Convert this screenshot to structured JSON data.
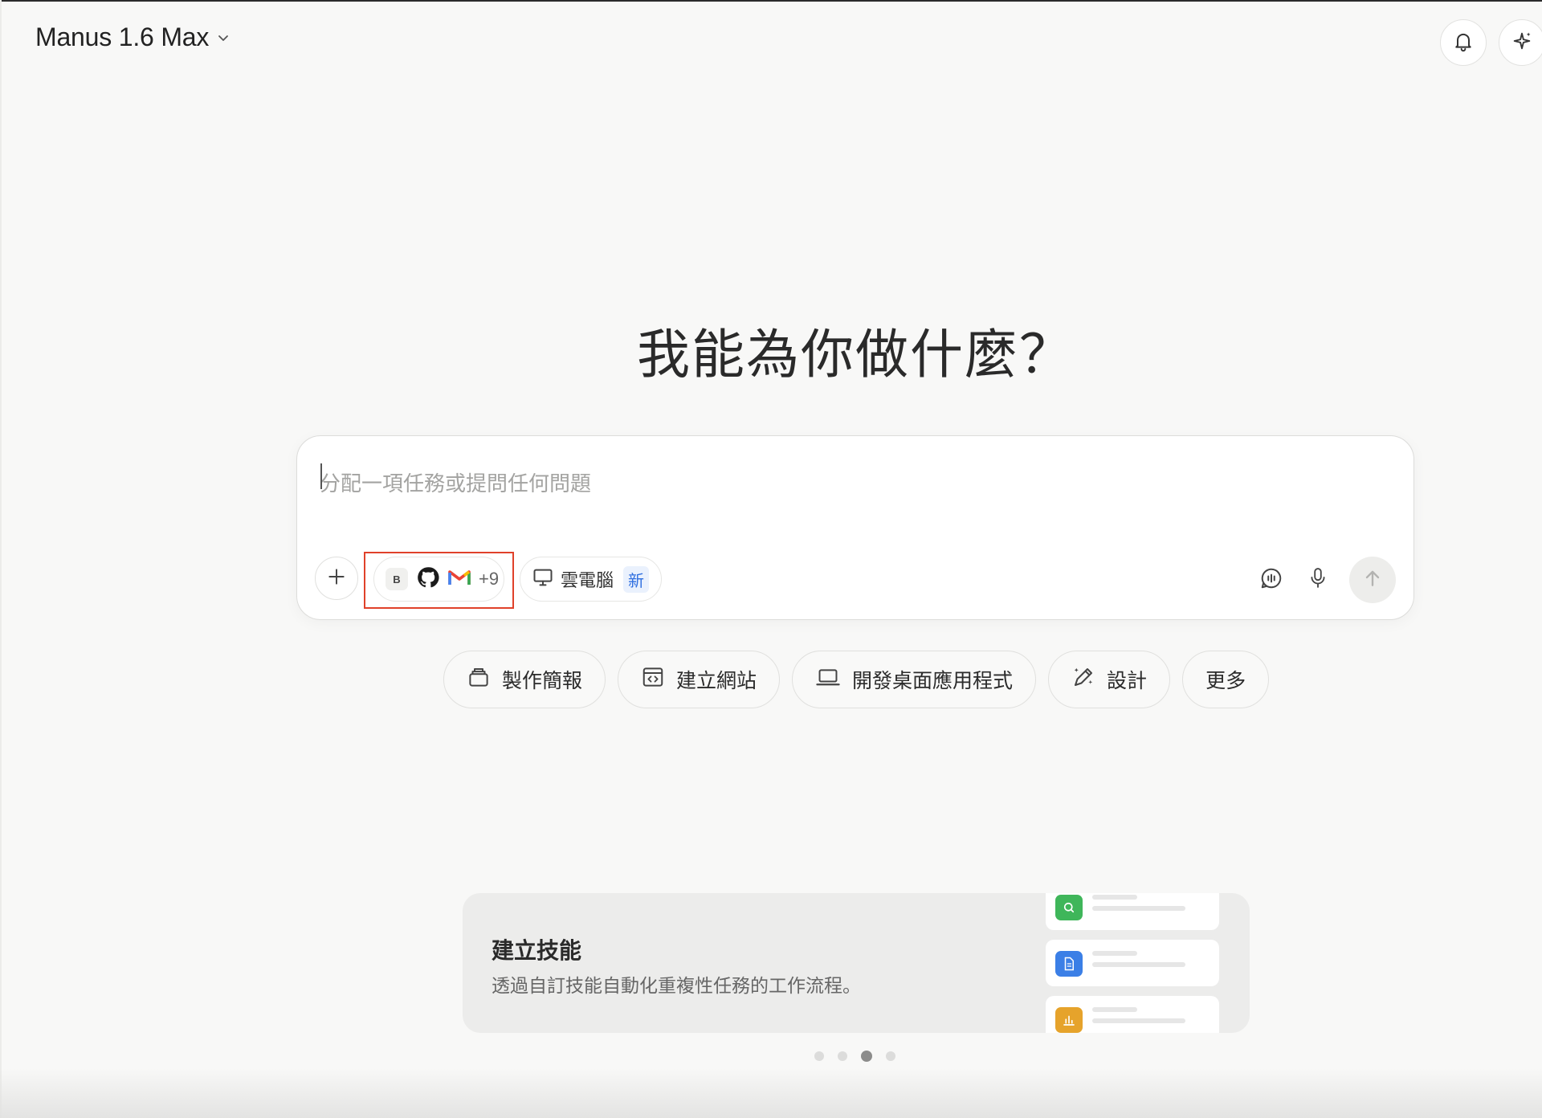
{
  "header": {
    "model_name": "Manus 1.6 Max",
    "icons": [
      "chevron-down-icon",
      "bell-icon",
      "sparkle-icon"
    ]
  },
  "hero": {
    "title": "我能為你做什麼？"
  },
  "composer": {
    "placeholder": "分配一項任務或提問任何問題",
    "connectors": {
      "badge_letter": "B",
      "more_count": "+9",
      "icons": [
        "github-icon",
        "gmail-icon"
      ],
      "highlight_color": "#e0412a"
    },
    "cloud_computer": {
      "label": "雲電腦",
      "badge": "新"
    }
  },
  "chips": [
    {
      "label": "製作簡報",
      "icon": "slides-icon"
    },
    {
      "label": "建立網站",
      "icon": "website-icon"
    },
    {
      "label": "開發桌面應用程式",
      "icon": "laptop-icon"
    },
    {
      "label": "設計",
      "icon": "design-icon"
    },
    {
      "label": "更多",
      "icon": ""
    }
  ],
  "skill_card": {
    "title": "建立技能",
    "description": "透過自訂技能自動化重複性任務的工作流程。",
    "mini_icon_colors": [
      "#3fb65a",
      "#3b7fe6",
      "#e6a32b"
    ]
  },
  "pagination": {
    "count": 4,
    "active_index": 2
  }
}
